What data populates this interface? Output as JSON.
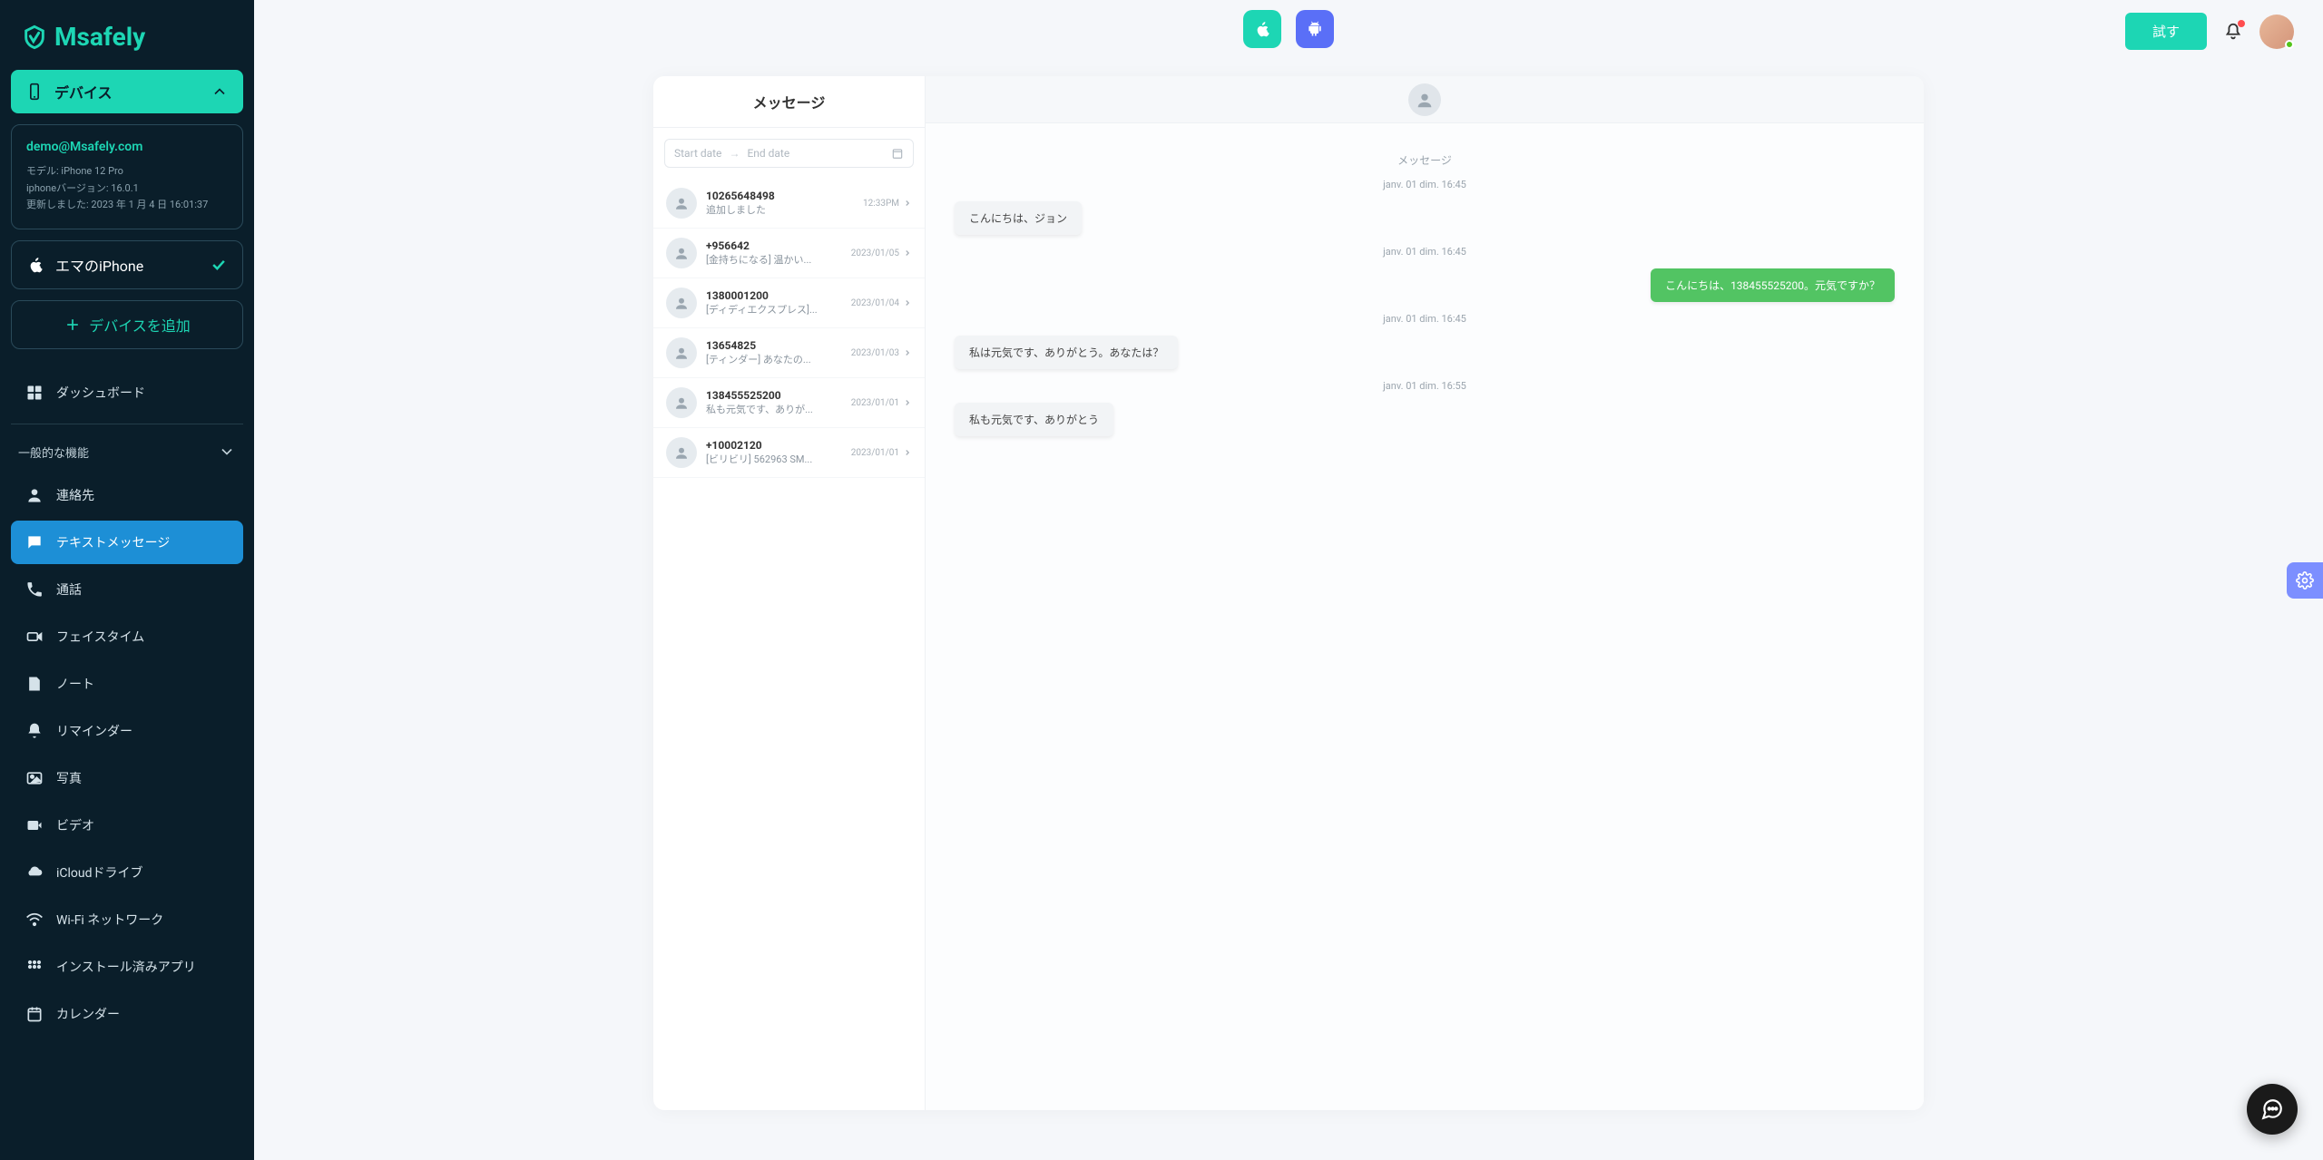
{
  "brand": "Msafely",
  "topbar": {
    "try_label": "試す"
  },
  "sidebar": {
    "device_section": "デバイス",
    "device_card": {
      "email": "demo@Msafely.com",
      "model_line": "モデル: iPhone 12 Pro",
      "version_line": "iphoneバージョン: 16.0.1",
      "updated_line": "更新しました: 2023 年 1 月 4 日 16:01:37"
    },
    "selected_device": "エマのiPhone",
    "add_device": "デバイスを追加",
    "dashboard": "ダッシュボード",
    "general_section": "一般的な機能",
    "items": {
      "contacts": "連絡先",
      "sms": "テキストメッセージ",
      "calls": "通話",
      "facetime": "フェイスタイム",
      "notes": "ノート",
      "reminders": "リマインダー",
      "photos": "写真",
      "videos": "ビデオ",
      "icloud": "iCloudドライブ",
      "wifi": "Wi-Fi ネットワーク",
      "apps": "インストール済みアプリ",
      "calendar": "カレンダー"
    }
  },
  "messages": {
    "title": "メッセージ",
    "date_start": "Start date",
    "date_end": "End date",
    "conversations": [
      {
        "title": "10265648498",
        "preview": "追加しました",
        "time": "12:33PM"
      },
      {
        "title": "+956642",
        "preview": "[金持ちになる] 温かい...",
        "time": "2023/01/05"
      },
      {
        "title": "1380001200",
        "preview": "[ディディエクスプレス]...",
        "time": "2023/01/04"
      },
      {
        "title": "13654825",
        "preview": "[ティンダー] あなたの...",
        "time": "2023/01/03"
      },
      {
        "title": "138455525200",
        "preview": "私も元気です、ありが...",
        "time": "2023/01/01"
      },
      {
        "title": "+10002120",
        "preview": "[ビリビリ] 562963 SM...",
        "time": "2023/01/01"
      }
    ]
  },
  "chat": {
    "header_label": "メッセージ",
    "thread": [
      {
        "type": "ts",
        "text": "janv. 01 dim. 16:45"
      },
      {
        "type": "in",
        "text": "こんにちは、ジョン"
      },
      {
        "type": "ts",
        "text": "janv. 01 dim. 16:45"
      },
      {
        "type": "out",
        "text": "こんにちは、138455525200。元気ですか？"
      },
      {
        "type": "ts",
        "text": "janv. 01 dim. 16:45"
      },
      {
        "type": "in",
        "text": "私は元気です、ありがとう。あなたは？"
      },
      {
        "type": "ts",
        "text": "janv. 01 dim. 16:55"
      },
      {
        "type": "in",
        "text": "私も元気です、ありがとう"
      }
    ]
  }
}
